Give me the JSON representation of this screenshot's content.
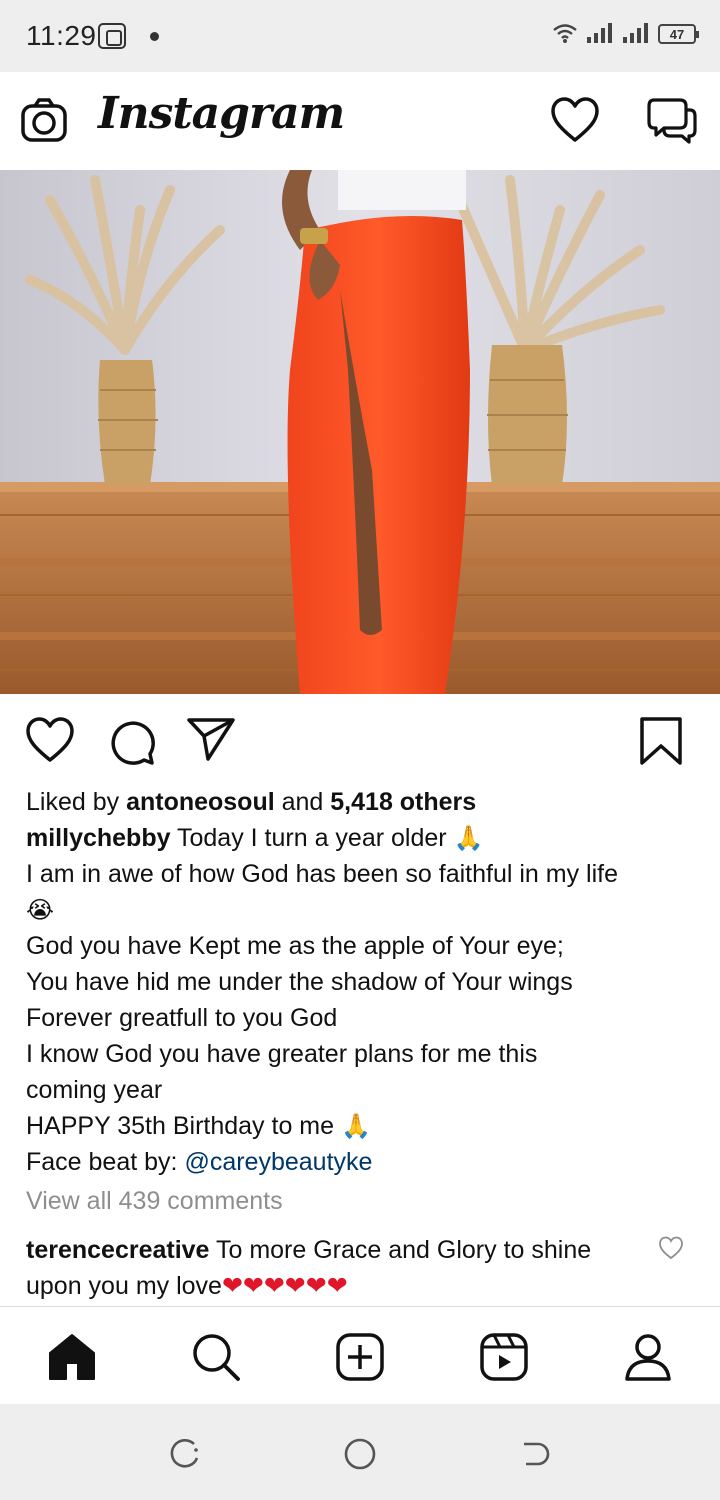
{
  "status_bar": {
    "time": "11:29",
    "battery": "47"
  },
  "header": {
    "logo": "Instagram",
    "icons": [
      "camera-icon",
      "heart-icon",
      "direct-message-icon"
    ]
  },
  "post": {
    "actions": [
      "like-icon",
      "comment-icon",
      "share-icon",
      "save-icon"
    ],
    "likes": {
      "prefix": "Liked by ",
      "user": "antoneosoul",
      "middle": " and ",
      "others": "5,418 others"
    },
    "caption": {
      "username": "millychebby",
      "line1": " Today I turn a year older ",
      "line2": "I am in awe of how God has been so faithful in my life",
      "line3": "God you have Kept me as the apple of Your eye;",
      "line4": "You have hid me under the shadow of Your wings",
      "line5": "Forever greatfull to you God",
      "line6": "I know God you have greater plans for me  this",
      "line7": "coming year",
      "line8": "HAPPY 35th Birthday to me ",
      "line9_prefix": "Face beat by: ",
      "mention": "@careybeautyke",
      "pray_emoji": "🙏",
      "cry_emoji": "😭"
    },
    "view_comments": "View all 439 comments",
    "top_comment": {
      "username": "terencecreative",
      "text": " To more Grace and Glory to shine upon you my love",
      "hearts": "❤❤❤❤❤❤"
    }
  },
  "bottom_nav": [
    "home-icon",
    "search-icon",
    "new-post-icon",
    "reels-icon",
    "profile-icon"
  ],
  "colors": {
    "accent_link": "#00376b",
    "heart_red": "#e0162b",
    "muted": "#8e8e8e"
  }
}
